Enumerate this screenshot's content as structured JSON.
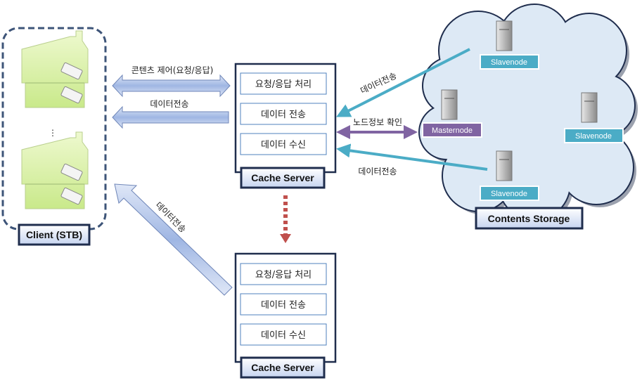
{
  "client": {
    "label": "Client (STB)",
    "ellipsis": "⋮"
  },
  "arrows": {
    "content_control": "콘텐츠 제어(요청/응답)",
    "data_transfer_to_client": "데이터전송",
    "data_transfer_diagonal": "데이터전송",
    "data_transfer_top": "데이터전송",
    "node_info_check": "노드정보 확인",
    "data_transfer_bottom": "데이터전송"
  },
  "cache_servers": [
    {
      "label": "Cache Server",
      "functions": [
        "요청/응답 처리",
        "데이터 전송",
        "데이터 수신"
      ]
    },
    {
      "label": "Cache Server",
      "functions": [
        "요청/응답 처리",
        "데이터 전송",
        "데이터 수신"
      ]
    }
  ],
  "storage": {
    "label": "Contents Storage",
    "nodes": [
      {
        "label": "Slavenode",
        "role": "slave"
      },
      {
        "label": "Masternode",
        "role": "master"
      },
      {
        "label": "Slavenode",
        "role": "slave"
      },
      {
        "label": "Slavenode",
        "role": "slave"
      }
    ]
  },
  "colors": {
    "navy": "#1f2d4d",
    "teal": "#4bacc6",
    "master": "#8064a2",
    "house": "#d7f0a0",
    "cloud": "#dde9f5",
    "red_dash": "#c0504d",
    "arrow_blue": "#b8c9ea"
  }
}
